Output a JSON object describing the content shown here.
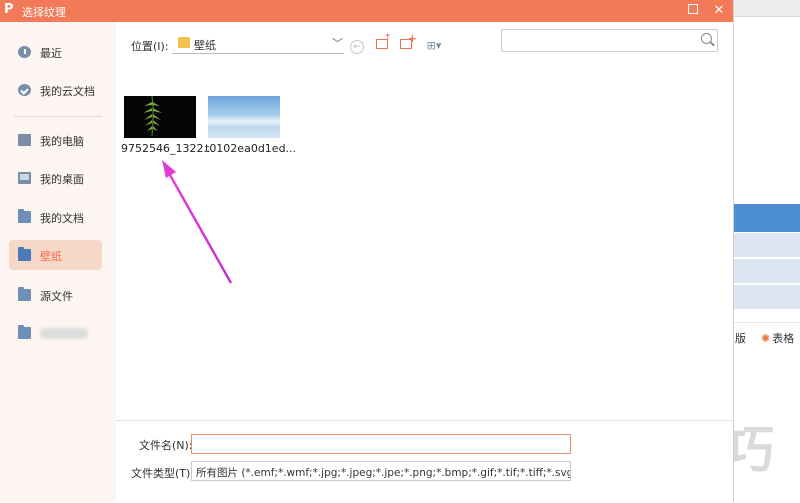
{
  "dialog": {
    "title": "选择纹理",
    "logo_char": "P",
    "maximize_icon": "maximize-icon",
    "close_icon": "close-icon",
    "accent": "#f27a58"
  },
  "sidebar": {
    "items": [
      {
        "label": "最近",
        "icon": "clock-icon"
      },
      {
        "label": "我的云文档",
        "icon": "cloud-icon"
      },
      {
        "label": "我的电脑",
        "icon": "monitor-icon"
      },
      {
        "label": "我的桌面",
        "icon": "desktop-icon"
      },
      {
        "label": "我的文档",
        "icon": "folder-icon"
      },
      {
        "label": "壁纸",
        "icon": "folder-icon",
        "active": true
      },
      {
        "label": "源文件",
        "icon": "folder-icon"
      },
      {
        "label": "",
        "icon": "folder-icon"
      }
    ]
  },
  "toolbar": {
    "location_label": "位置(I):",
    "location_value": "壁纸",
    "search_placeholder": ""
  },
  "files": [
    {
      "name": "9752546_1322...",
      "thumb": "plant"
    },
    {
      "name": "t0102ea0d1ed...",
      "thumb": "sky"
    }
  ],
  "bottom": {
    "filename_label": "文件名(N):",
    "filename_value": "",
    "filetype_label": "文件类型(T):",
    "filetype_value": "所有图片 (*.emf;*.wmf;*.jpg;*.jpeg;*.jpe;*.png;*.bmp;*.gif;*.tif;*.tiff;*.svg)"
  },
  "background_app": {
    "ribbon_item_1": "版",
    "ribbon_item_2": "表格"
  },
  "watermark": "软件技巧"
}
